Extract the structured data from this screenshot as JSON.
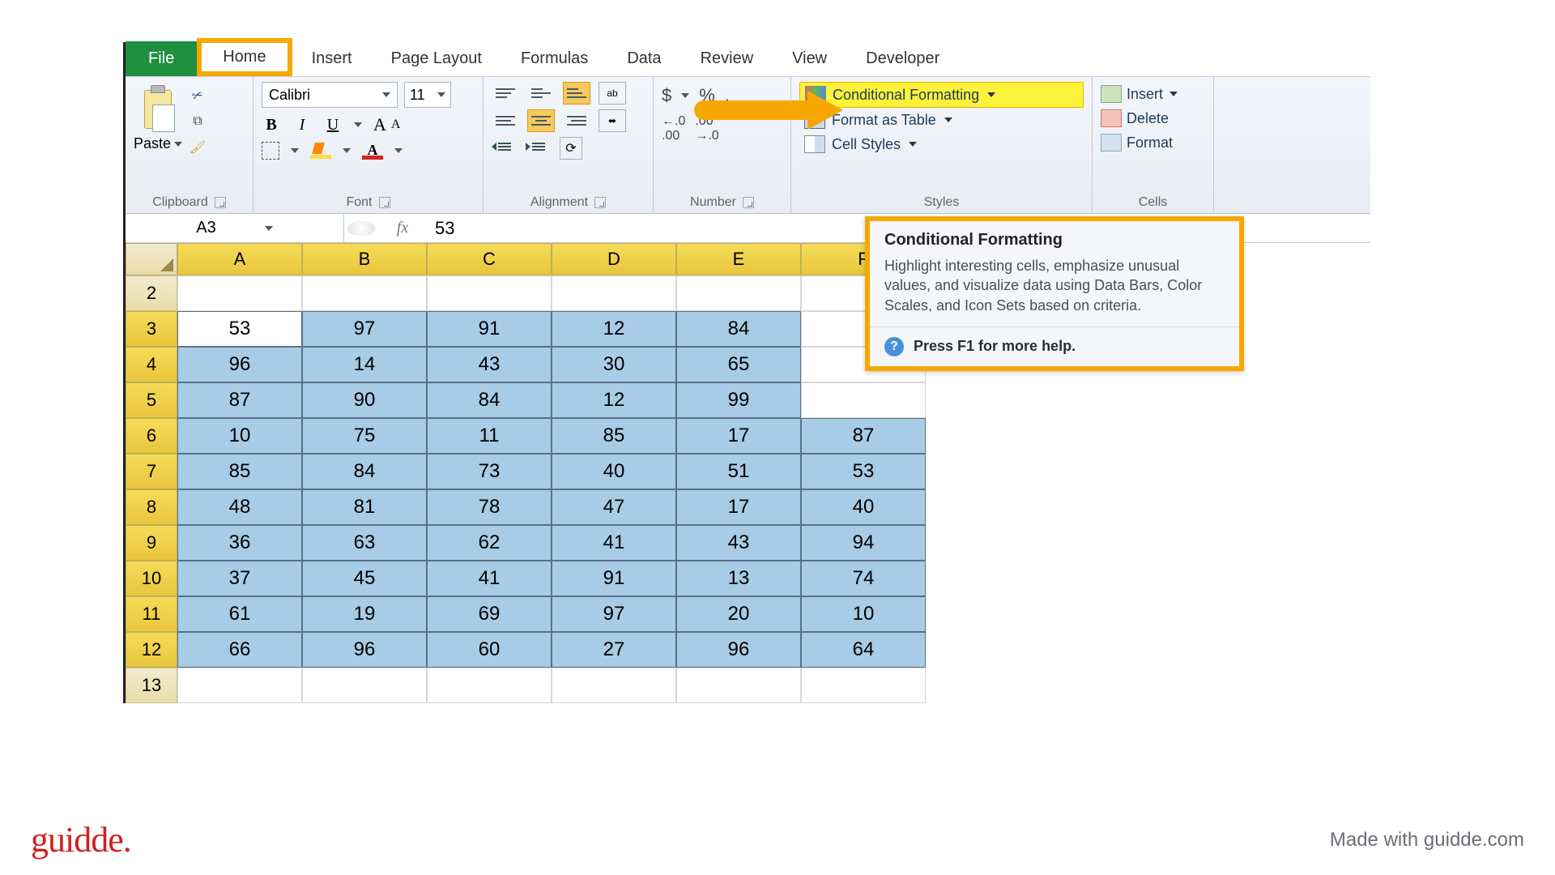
{
  "tabs": {
    "file": "File",
    "home": "Home",
    "insert": "Insert",
    "page_layout": "Page Layout",
    "formulas": "Formulas",
    "data": "Data",
    "review": "Review",
    "view": "View",
    "developer": "Developer"
  },
  "ribbon": {
    "clipboard": {
      "paste": "Paste",
      "label": "Clipboard"
    },
    "font": {
      "name": "Calibri",
      "size": "11",
      "label": "Font"
    },
    "alignment": {
      "label": "Alignment"
    },
    "number": {
      "label": "Number",
      "dollar": "$",
      "percent": "%",
      "comma": ",",
      "inc_dec": "←.0",
      "dec_dec": ".00→",
      "inc": ".00",
      "dec": ".0"
    },
    "styles": {
      "label": "Styles",
      "conditional_formatting": "Conditional Formatting",
      "format_as_table": "Format as Table",
      "cell_styles": "Cell Styles"
    },
    "cells": {
      "label": "Cells",
      "insert": "Insert",
      "delete": "Delete",
      "format": "Format"
    }
  },
  "formula_bar": {
    "cell_ref": "A3",
    "fx": "fx",
    "value": "53"
  },
  "sheet": {
    "columns": [
      "A",
      "B",
      "C",
      "D",
      "E",
      "F"
    ],
    "row_headers": [
      "2",
      "3",
      "4",
      "5",
      "6",
      "7",
      "8",
      "9",
      "10",
      "11",
      "12",
      "13"
    ],
    "data": [
      [
        "53",
        "97",
        "91",
        "12",
        "84",
        ""
      ],
      [
        "96",
        "14",
        "43",
        "30",
        "65",
        ""
      ],
      [
        "87",
        "90",
        "84",
        "12",
        "99",
        ""
      ],
      [
        "10",
        "75",
        "11",
        "85",
        "17",
        "87"
      ],
      [
        "85",
        "84",
        "73",
        "40",
        "51",
        "53"
      ],
      [
        "48",
        "81",
        "78",
        "47",
        "17",
        "40"
      ],
      [
        "36",
        "63",
        "62",
        "41",
        "43",
        "94"
      ],
      [
        "37",
        "45",
        "41",
        "91",
        "13",
        "74"
      ],
      [
        "61",
        "19",
        "69",
        "97",
        "20",
        "10"
      ],
      [
        "66",
        "96",
        "60",
        "27",
        "96",
        "64"
      ]
    ]
  },
  "tooltip": {
    "title": "Conditional Formatting",
    "body": "Highlight interesting cells, emphasize unusual values, and visualize data using Data Bars, Color Scales, and Icon Sets based on criteria.",
    "help": "Press F1 for more help."
  },
  "footer": {
    "logo": "guidde.",
    "madewith": "Made with guidde.com"
  }
}
